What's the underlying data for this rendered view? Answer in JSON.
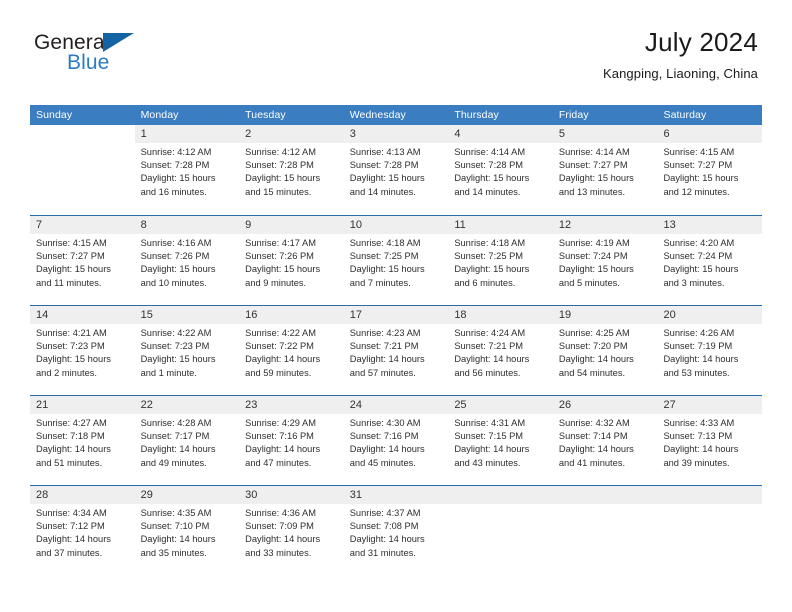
{
  "brand": {
    "word_one": "General",
    "word_two": "Blue",
    "flag_icon": "triangle-flag-icon"
  },
  "header": {
    "title": "July 2024",
    "location": "Kangping, Liaoning, China"
  },
  "colors": {
    "header_blue": "#3A7DC1",
    "row_divider_blue": "#2A6BA8",
    "daynum_band": "#EFEFEF",
    "brand_blue": "#2B7CC4",
    "flag_blue": "#1463A3",
    "text": "#2E2E2E"
  },
  "calendar": {
    "day_headers": [
      "Sunday",
      "Monday",
      "Tuesday",
      "Wednesday",
      "Thursday",
      "Friday",
      "Saturday"
    ],
    "weeks": [
      [
        {
          "day": "",
          "blank": true,
          "sunrise": "",
          "sunset": "",
          "daylight_line1": "",
          "daylight_line2": ""
        },
        {
          "day": "1",
          "sunrise": "Sunrise: 4:12 AM",
          "sunset": "Sunset: 7:28 PM",
          "daylight_line1": "Daylight: 15 hours",
          "daylight_line2": "and 16 minutes."
        },
        {
          "day": "2",
          "sunrise": "Sunrise: 4:12 AM",
          "sunset": "Sunset: 7:28 PM",
          "daylight_line1": "Daylight: 15 hours",
          "daylight_line2": "and 15 minutes."
        },
        {
          "day": "3",
          "sunrise": "Sunrise: 4:13 AM",
          "sunset": "Sunset: 7:28 PM",
          "daylight_line1": "Daylight: 15 hours",
          "daylight_line2": "and 14 minutes."
        },
        {
          "day": "4",
          "sunrise": "Sunrise: 4:14 AM",
          "sunset": "Sunset: 7:28 PM",
          "daylight_line1": "Daylight: 15 hours",
          "daylight_line2": "and 14 minutes."
        },
        {
          "day": "5",
          "sunrise": "Sunrise: 4:14 AM",
          "sunset": "Sunset: 7:27 PM",
          "daylight_line1": "Daylight: 15 hours",
          "daylight_line2": "and 13 minutes."
        },
        {
          "day": "6",
          "sunrise": "Sunrise: 4:15 AM",
          "sunset": "Sunset: 7:27 PM",
          "daylight_line1": "Daylight: 15 hours",
          "daylight_line2": "and 12 minutes."
        }
      ],
      [
        {
          "day": "7",
          "sunrise": "Sunrise: 4:15 AM",
          "sunset": "Sunset: 7:27 PM",
          "daylight_line1": "Daylight: 15 hours",
          "daylight_line2": "and 11 minutes."
        },
        {
          "day": "8",
          "sunrise": "Sunrise: 4:16 AM",
          "sunset": "Sunset: 7:26 PM",
          "daylight_line1": "Daylight: 15 hours",
          "daylight_line2": "and 10 minutes."
        },
        {
          "day": "9",
          "sunrise": "Sunrise: 4:17 AM",
          "sunset": "Sunset: 7:26 PM",
          "daylight_line1": "Daylight: 15 hours",
          "daylight_line2": "and 9 minutes."
        },
        {
          "day": "10",
          "sunrise": "Sunrise: 4:18 AM",
          "sunset": "Sunset: 7:25 PM",
          "daylight_line1": "Daylight: 15 hours",
          "daylight_line2": "and 7 minutes."
        },
        {
          "day": "11",
          "sunrise": "Sunrise: 4:18 AM",
          "sunset": "Sunset: 7:25 PM",
          "daylight_line1": "Daylight: 15 hours",
          "daylight_line2": "and 6 minutes."
        },
        {
          "day": "12",
          "sunrise": "Sunrise: 4:19 AM",
          "sunset": "Sunset: 7:24 PM",
          "daylight_line1": "Daylight: 15 hours",
          "daylight_line2": "and 5 minutes."
        },
        {
          "day": "13",
          "sunrise": "Sunrise: 4:20 AM",
          "sunset": "Sunset: 7:24 PM",
          "daylight_line1": "Daylight: 15 hours",
          "daylight_line2": "and 3 minutes."
        }
      ],
      [
        {
          "day": "14",
          "sunrise": "Sunrise: 4:21 AM",
          "sunset": "Sunset: 7:23 PM",
          "daylight_line1": "Daylight: 15 hours",
          "daylight_line2": "and 2 minutes."
        },
        {
          "day": "15",
          "sunrise": "Sunrise: 4:22 AM",
          "sunset": "Sunset: 7:23 PM",
          "daylight_line1": "Daylight: 15 hours",
          "daylight_line2": "and 1 minute."
        },
        {
          "day": "16",
          "sunrise": "Sunrise: 4:22 AM",
          "sunset": "Sunset: 7:22 PM",
          "daylight_line1": "Daylight: 14 hours",
          "daylight_line2": "and 59 minutes."
        },
        {
          "day": "17",
          "sunrise": "Sunrise: 4:23 AM",
          "sunset": "Sunset: 7:21 PM",
          "daylight_line1": "Daylight: 14 hours",
          "daylight_line2": "and 57 minutes."
        },
        {
          "day": "18",
          "sunrise": "Sunrise: 4:24 AM",
          "sunset": "Sunset: 7:21 PM",
          "daylight_line1": "Daylight: 14 hours",
          "daylight_line2": "and 56 minutes."
        },
        {
          "day": "19",
          "sunrise": "Sunrise: 4:25 AM",
          "sunset": "Sunset: 7:20 PM",
          "daylight_line1": "Daylight: 14 hours",
          "daylight_line2": "and 54 minutes."
        },
        {
          "day": "20",
          "sunrise": "Sunrise: 4:26 AM",
          "sunset": "Sunset: 7:19 PM",
          "daylight_line1": "Daylight: 14 hours",
          "daylight_line2": "and 53 minutes."
        }
      ],
      [
        {
          "day": "21",
          "sunrise": "Sunrise: 4:27 AM",
          "sunset": "Sunset: 7:18 PM",
          "daylight_line1": "Daylight: 14 hours",
          "daylight_line2": "and 51 minutes."
        },
        {
          "day": "22",
          "sunrise": "Sunrise: 4:28 AM",
          "sunset": "Sunset: 7:17 PM",
          "daylight_line1": "Daylight: 14 hours",
          "daylight_line2": "and 49 minutes."
        },
        {
          "day": "23",
          "sunrise": "Sunrise: 4:29 AM",
          "sunset": "Sunset: 7:16 PM",
          "daylight_line1": "Daylight: 14 hours",
          "daylight_line2": "and 47 minutes."
        },
        {
          "day": "24",
          "sunrise": "Sunrise: 4:30 AM",
          "sunset": "Sunset: 7:16 PM",
          "daylight_line1": "Daylight: 14 hours",
          "daylight_line2": "and 45 minutes."
        },
        {
          "day": "25",
          "sunrise": "Sunrise: 4:31 AM",
          "sunset": "Sunset: 7:15 PM",
          "daylight_line1": "Daylight: 14 hours",
          "daylight_line2": "and 43 minutes."
        },
        {
          "day": "26",
          "sunrise": "Sunrise: 4:32 AM",
          "sunset": "Sunset: 7:14 PM",
          "daylight_line1": "Daylight: 14 hours",
          "daylight_line2": "and 41 minutes."
        },
        {
          "day": "27",
          "sunrise": "Sunrise: 4:33 AM",
          "sunset": "Sunset: 7:13 PM",
          "daylight_line1": "Daylight: 14 hours",
          "daylight_line2": "and 39 minutes."
        }
      ],
      [
        {
          "day": "28",
          "sunrise": "Sunrise: 4:34 AM",
          "sunset": "Sunset: 7:12 PM",
          "daylight_line1": "Daylight: 14 hours",
          "daylight_line2": "and 37 minutes."
        },
        {
          "day": "29",
          "sunrise": "Sunrise: 4:35 AM",
          "sunset": "Sunset: 7:10 PM",
          "daylight_line1": "Daylight: 14 hours",
          "daylight_line2": "and 35 minutes."
        },
        {
          "day": "30",
          "sunrise": "Sunrise: 4:36 AM",
          "sunset": "Sunset: 7:09 PM",
          "daylight_line1": "Daylight: 14 hours",
          "daylight_line2": "and 33 minutes."
        },
        {
          "day": "31",
          "sunrise": "Sunrise: 4:37 AM",
          "sunset": "Sunset: 7:08 PM",
          "daylight_line1": "Daylight: 14 hours",
          "daylight_line2": "and 31 minutes."
        },
        {
          "day": "",
          "empty": true,
          "sunrise": "",
          "sunset": "",
          "daylight_line1": "",
          "daylight_line2": ""
        },
        {
          "day": "",
          "empty": true,
          "sunrise": "",
          "sunset": "",
          "daylight_line1": "",
          "daylight_line2": ""
        },
        {
          "day": "",
          "empty": true,
          "sunrise": "",
          "sunset": "",
          "daylight_line1": "",
          "daylight_line2": ""
        }
      ]
    ]
  }
}
